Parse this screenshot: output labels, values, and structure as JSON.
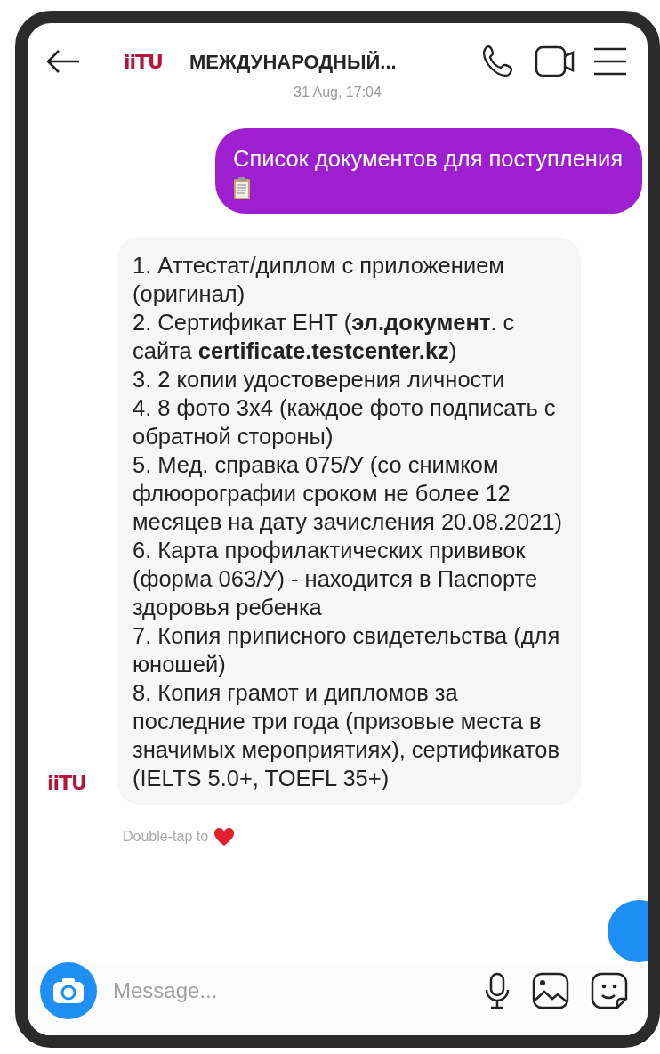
{
  "header": {
    "logo": "iiTU",
    "title": "МЕЖДУНАРОДНЫЙ..."
  },
  "timestamp": "31 Aug, 17:04",
  "messages": [
    {
      "kind": "sent",
      "text": "Список документов для поступления",
      "clipboard_emoji": true
    },
    {
      "kind": "received",
      "avatar": "iiTU",
      "lines": [
        "1. Аттестат/диплом с приложением (оригинал)",
        "2. Сертификат ЕНТ (**эл.документ**. с сайта **certificate.testcenter.kz**)",
        "3. 2 копии удостоверения личности",
        "4. 8 фото 3х4 (каждое фото подписать с обратной стороны)",
        "5. Мед. справка 075/У (со снимком флюорографии сроком не более 12 месяцев на дату зачисления 20.08.2021)",
        "6. Карта профилактических прививок (форма 063/У) - находится в Паспорте здоровья ребенка",
        "7. Копия приписного свидетельства (для юношей)",
        "8. Копия грамот и дипломов за последние три года (призовые места в значимых мероприятиях), сертификатов (IELTS 5.0+, TOEFL 35+)"
      ]
    }
  ],
  "hint": "Double-tap to",
  "composer": {
    "placeholder": "Message..."
  }
}
